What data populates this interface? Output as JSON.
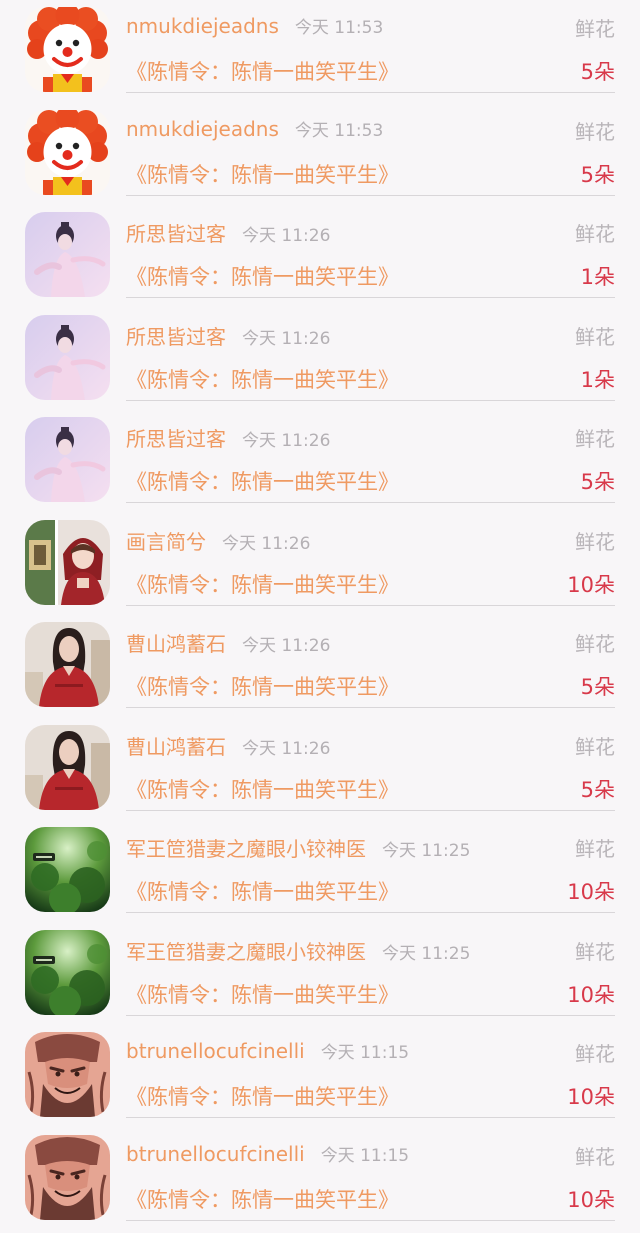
{
  "gift_list": {
    "rows": [
      {
        "username": "nmukdiejeadns",
        "time": "今天 11:53",
        "gift_type": "鲜花",
        "work_title": "《陈情令：陈情一曲笑平生》",
        "count": "5朵",
        "avatar_icon": "clown-avatar"
      },
      {
        "username": "nmukdiejeadns",
        "time": "今天 11:53",
        "gift_type": "鲜花",
        "work_title": "《陈情令：陈情一曲笑平生》",
        "count": "5朵",
        "avatar_icon": "clown-avatar"
      },
      {
        "username": "所思皆过客",
        "time": "今天 11:26",
        "gift_type": "鲜花",
        "work_title": "《陈情令：陈情一曲笑平生》",
        "count": "1朵",
        "avatar_icon": "hanfu-girl-avatar"
      },
      {
        "username": "所思皆过客",
        "time": "今天 11:26",
        "gift_type": "鲜花",
        "work_title": "《陈情令：陈情一曲笑平生》",
        "count": "1朵",
        "avatar_icon": "hanfu-girl-avatar"
      },
      {
        "username": "所思皆过客",
        "time": "今天 11:26",
        "gift_type": "鲜花",
        "work_title": "《陈情令：陈情一曲笑平生》",
        "count": "5朵",
        "avatar_icon": "hanfu-girl-avatar"
      },
      {
        "username": "画言简兮",
        "time": "今天 11:26",
        "gift_type": "鲜花",
        "work_title": "《陈情令：陈情一曲笑平生》",
        "count": "10朵",
        "avatar_icon": "red-hood-girl-avatar"
      },
      {
        "username": "曹山鸿蓄石",
        "time": "今天 11:26",
        "gift_type": "鲜花",
        "work_title": "《陈情令：陈情一曲笑平生》",
        "count": "5朵",
        "avatar_icon": "red-dress-woman-avatar"
      },
      {
        "username": "曹山鸿蓄石",
        "time": "今天 11:26",
        "gift_type": "鲜花",
        "work_title": "《陈情令：陈情一曲笑平生》",
        "count": "5朵",
        "avatar_icon": "red-dress-woman-avatar"
      },
      {
        "username": "军王笸猎妻之魔眼小铰神医",
        "time": "今天 11:25",
        "gift_type": "鲜花",
        "work_title": "《陈情令：陈情一曲笑平生》",
        "count": "10朵",
        "avatar_icon": "green-forest-avatar"
      },
      {
        "username": "军王笸猎妻之魔眼小铰神医",
        "time": "今天 11:25",
        "gift_type": "鲜花",
        "work_title": "《陈情令：陈情一曲笑平生》",
        "count": "10朵",
        "avatar_icon": "green-forest-avatar"
      },
      {
        "username": "btrunellocufcinelli",
        "time": "今天 11:15",
        "gift_type": "鲜花",
        "work_title": "《陈情令：陈情一曲笑平生》",
        "count": "10朵",
        "avatar_icon": "warrior-tattoo-avatar"
      },
      {
        "username": "btrunellocufcinelli",
        "time": "今天 11:15",
        "gift_type": "鲜花",
        "work_title": "《陈情令：陈情一曲笑平生》",
        "count": "10朵",
        "avatar_icon": "warrior-tattoo-avatar"
      }
    ]
  },
  "colors": {
    "name": "#ef9a62",
    "time": "#b4b0b4",
    "gift_type": "#b9b5b9",
    "count": "#d8394a",
    "background": "#f8f6f8"
  }
}
